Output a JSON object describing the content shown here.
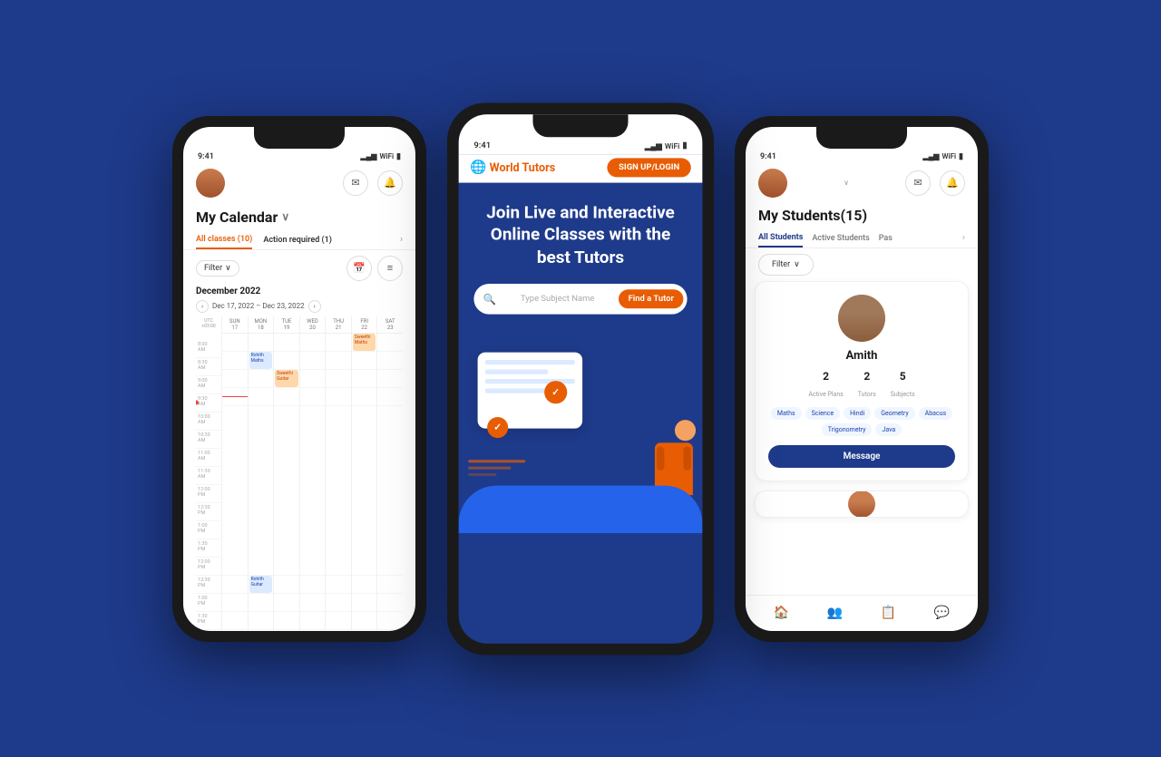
{
  "background_color": "#1e3a8a",
  "phones": {
    "phone1": {
      "status_time": "9:41",
      "title": "My Calendar",
      "title_arrow": "∨",
      "tab_all": "All classes (10)",
      "tab_action": "Action required (1)",
      "filter_label": "Filter",
      "month_label": "December 2022",
      "date_range": "Dec 17, 2022 – Dec 23, 2022",
      "days": [
        "UTC +03:00",
        "SUN 17",
        "MON 18",
        "TUE 19",
        "WED 20",
        "THU 21",
        "FRI 22",
        "SAT 23"
      ],
      "times": [
        "8:00 AM",
        "8:30 AM",
        "9:00 AM",
        "9:30 AM",
        "10:00 AM",
        "10:30 AM",
        "11:00 AM",
        "11:30 AM",
        "12:00 PM",
        "12:30 PM",
        "1:00 PM",
        "1:30 PM"
      ],
      "event1_name": "Rohith",
      "event1_sub": "Maths",
      "event2_name": "Sweethi",
      "event2_sub": "Maths",
      "event3_name": "Sweethi",
      "event3_sub": "Guitar",
      "event4_name": "Rohith",
      "event4_sub": "Guitar"
    },
    "phone2": {
      "status_time": "9:41",
      "logo_text": "World",
      "logo_highlight": "Tutors",
      "logo_icon": "🌐",
      "signup_label": "SIGN UP/LOGIN",
      "hero_title": "Join Live and Interactive Online Classes with the best Tutors",
      "search_placeholder": "Type Subject Name",
      "find_tutor_label": "Find a Tutor"
    },
    "phone3": {
      "status_time": "9:41",
      "title": "My Students(15)",
      "tab_all": "All Students",
      "tab_active": "Active Students",
      "tab_past": "Pas",
      "filter_label": "Filter",
      "student": {
        "name": "Amith",
        "active_plans": "2",
        "active_plans_label": "Active Plans",
        "tutors": "2",
        "tutors_label": "Tutors",
        "subjects_count": "5",
        "subjects_label": "Subjects",
        "tags": [
          "Maths",
          "Science",
          "Hindi",
          "Geometry",
          "Abacus",
          "Trigonometry",
          "Java"
        ],
        "message_label": "Message"
      },
      "nav_icons": [
        "🏠",
        "👥",
        "📋",
        "💬"
      ]
    }
  }
}
